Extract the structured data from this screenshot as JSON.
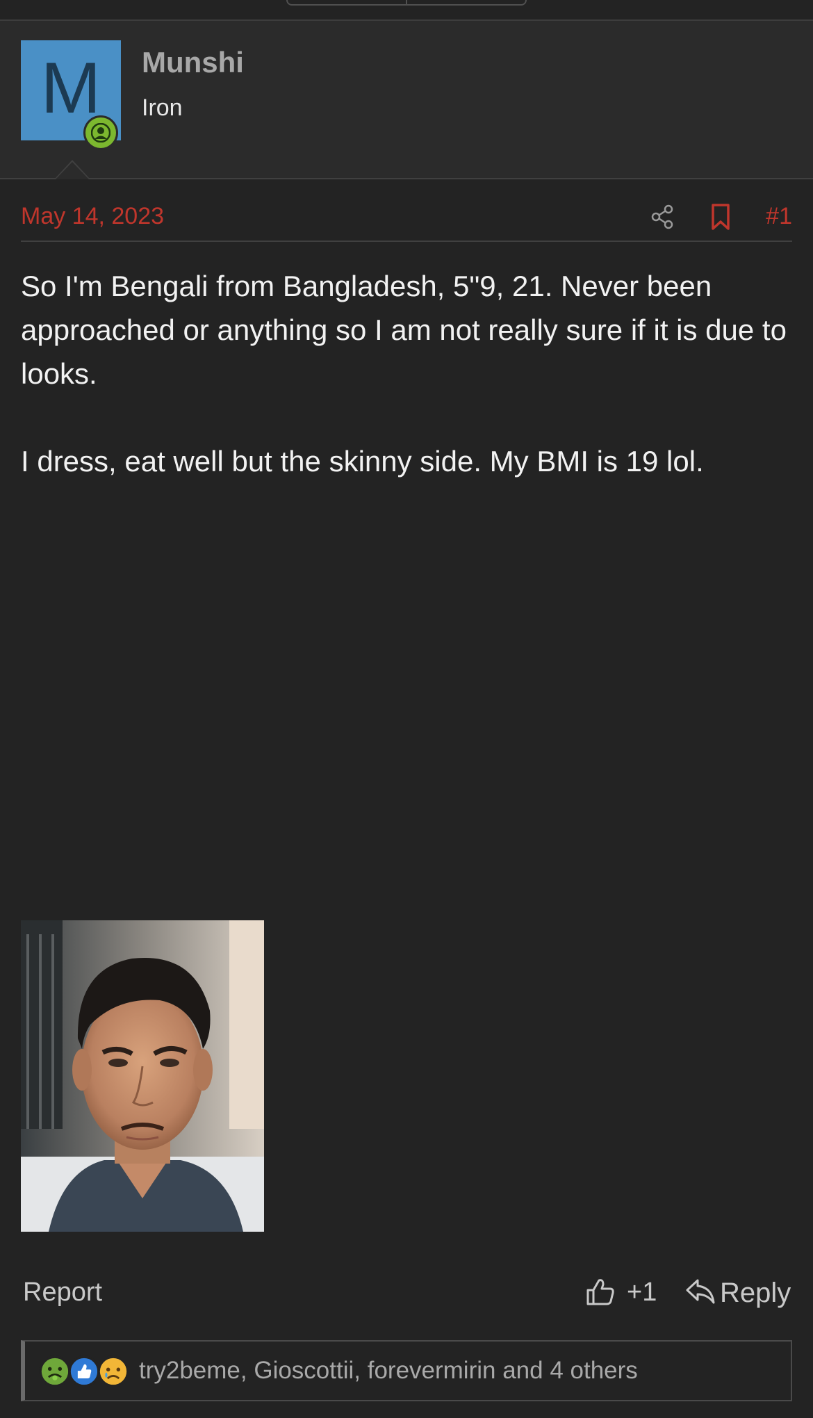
{
  "user": {
    "avatar_letter": "M",
    "name": "Munshi",
    "title": "Iron",
    "avatar_color": "#4a90c6",
    "online_color": "#7cb82f"
  },
  "post": {
    "date": "May 14, 2023",
    "number": "#1",
    "paragraphs": [
      "So I'm Bengali from Bangladesh, 5\"9, 21. Never been approached or anything so I am not really sure if it is due to looks.",
      "I dress, eat well but the skinny side. My BMI is 19 lol."
    ],
    "image_alt": "Portrait photo of the poster"
  },
  "actions": {
    "report_label": "Report",
    "like_label": "+1",
    "reply_label": "Reply"
  },
  "reactions": {
    "icons": [
      "sick-face-icon",
      "thumbs-up-icon",
      "sad-face-icon"
    ],
    "summary": "try2beme, Gioscottii, forevermirin and 4 others"
  },
  "colors": {
    "background": "#232323",
    "header_bg": "#2b2b2b",
    "accent_red": "#c0362c"
  }
}
